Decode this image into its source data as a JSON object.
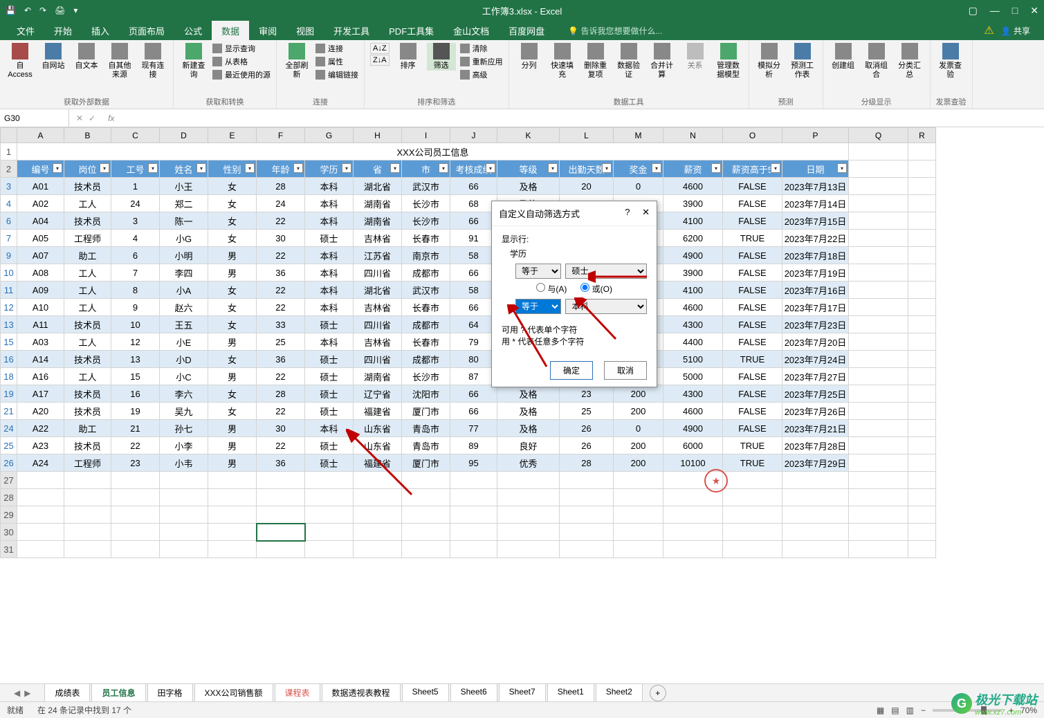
{
  "app": {
    "title": "工作簿3.xlsx - Excel",
    "qat_tooltips": [
      "保存",
      "撤销",
      "重做",
      "打印",
      "新建"
    ],
    "window_controls": [
      "⊞",
      "—",
      "□",
      "✕"
    ]
  },
  "ribbon_tabs": [
    "文件",
    "开始",
    "插入",
    "页面布局",
    "公式",
    "数据",
    "审阅",
    "视图",
    "开发工具",
    "PDF工具集",
    "金山文档",
    "百度网盘"
  ],
  "active_tab": "数据",
  "tellme_placeholder": "告诉我您想要做什么...",
  "share_label": "共享",
  "ribbon": {
    "group1": {
      "btns": [
        "自 Access",
        "自网站",
        "自文本",
        "自其他来源",
        "现有连接"
      ],
      "label": "获取外部数据"
    },
    "group2": {
      "btn": "新建查询",
      "list": [
        "显示查询",
        "从表格",
        "最近使用的源"
      ],
      "label": "获取和转换"
    },
    "group3": {
      "btn": "全部刷新",
      "list": [
        "连接",
        "属性",
        "编辑链接"
      ],
      "label": "连接"
    },
    "group4": {
      "btns": [
        "排序",
        "筛选"
      ],
      "list": [
        "清除",
        "重新应用",
        "高级"
      ],
      "small": [
        "A↓Z",
        "Z↓A"
      ],
      "label": "排序和筛选"
    },
    "group5": {
      "btns": [
        "分列",
        "快速填充",
        "删除重复项",
        "数据验证",
        "合并计算",
        "关系",
        "管理数据模型"
      ],
      "label": "数据工具"
    },
    "group6": {
      "btns": [
        "模拟分析",
        "预测工作表"
      ],
      "label": "预测"
    },
    "group7": {
      "btns": [
        "创建组",
        "取消组合",
        "分类汇总"
      ],
      "label": "分级显示"
    },
    "group8": {
      "btn": "发票查验",
      "label": "发票查验"
    }
  },
  "formula": {
    "cell_ref": "G30",
    "fx": "fx"
  },
  "columns": [
    "A",
    "B",
    "C",
    "D",
    "E",
    "F",
    "G",
    "H",
    "I",
    "J",
    "K",
    "L",
    "M",
    "N",
    "O",
    "P",
    "Q",
    "R"
  ],
  "sheet_title": "XXX公司员工信息",
  "headers": [
    "编号",
    "岗位",
    "工号",
    "姓名",
    "性别",
    "年龄",
    "学历",
    "省",
    "市",
    "考核成绩",
    "等级",
    "出勤天数",
    "奖金",
    "薪资",
    "薪资高于5",
    "日期"
  ],
  "rows": [
    {
      "n": 3,
      "d": [
        "A01",
        "技术员",
        "1",
        "小王",
        "女",
        "28",
        "本科",
        "湖北省",
        "武汉市",
        "66",
        "及格",
        "20",
        "0",
        "4600",
        "FALSE",
        "2023年7月13日"
      ]
    },
    {
      "n": 4,
      "d": [
        "A02",
        "工人",
        "24",
        "郑二",
        "女",
        "24",
        "本科",
        "湖南省",
        "长沙市",
        "68",
        "及格",
        "21",
        "0",
        "3900",
        "FALSE",
        "2023年7月14日"
      ]
    },
    {
      "n": 6,
      "d": [
        "A04",
        "技术员",
        "3",
        "陈一",
        "女",
        "22",
        "本科",
        "湖南省",
        "长沙市",
        "66",
        "",
        "",
        "",
        "4100",
        "FALSE",
        "2023年7月15日"
      ]
    },
    {
      "n": 7,
      "d": [
        "A05",
        "工程师",
        "4",
        "小G",
        "女",
        "30",
        "硕士",
        "吉林省",
        "长春市",
        "91",
        "",
        "",
        "",
        "6200",
        "TRUE",
        "2023年7月22日"
      ]
    },
    {
      "n": 9,
      "d": [
        "A07",
        "助工",
        "6",
        "小明",
        "男",
        "22",
        "本科",
        "江苏省",
        "南京市",
        "58",
        "",
        "",
        "",
        "4900",
        "FALSE",
        "2023年7月18日"
      ]
    },
    {
      "n": 10,
      "d": [
        "A08",
        "工人",
        "7",
        "李四",
        "男",
        "36",
        "本科",
        "四川省",
        "成都市",
        "66",
        "",
        "",
        "",
        "3900",
        "FALSE",
        "2023年7月19日"
      ]
    },
    {
      "n": 11,
      "d": [
        "A09",
        "工人",
        "8",
        "小A",
        "女",
        "22",
        "本科",
        "湖北省",
        "武汉市",
        "58",
        "",
        "",
        "",
        "4100",
        "FALSE",
        "2023年7月16日"
      ]
    },
    {
      "n": 12,
      "d": [
        "A10",
        "工人",
        "9",
        "赵六",
        "女",
        "22",
        "本科",
        "吉林省",
        "长春市",
        "66",
        "",
        "",
        "",
        "4600",
        "FALSE",
        "2023年7月17日"
      ]
    },
    {
      "n": 13,
      "d": [
        "A11",
        "技术员",
        "10",
        "王五",
        "女",
        "33",
        "硕士",
        "四川省",
        "成都市",
        "64",
        "",
        "",
        "",
        "4300",
        "FALSE",
        "2023年7月23日"
      ]
    },
    {
      "n": 15,
      "d": [
        "A03",
        "工人",
        "12",
        "小E",
        "男",
        "25",
        "本科",
        "吉林省",
        "长春市",
        "79",
        "",
        "",
        "",
        "4400",
        "FALSE",
        "2023年7月20日"
      ]
    },
    {
      "n": 16,
      "d": [
        "A14",
        "技术员",
        "13",
        "小D",
        "女",
        "36",
        "硕士",
        "四川省",
        "成都市",
        "80",
        "",
        "",
        "",
        "5100",
        "TRUE",
        "2023年7月24日"
      ]
    },
    {
      "n": 18,
      "d": [
        "A16",
        "工人",
        "15",
        "小C",
        "男",
        "22",
        "硕士",
        "湖南省",
        "长沙市",
        "87",
        "",
        "",
        "",
        "5000",
        "FALSE",
        "2023年7月27日"
      ]
    },
    {
      "n": 19,
      "d": [
        "A17",
        "技术员",
        "16",
        "李六",
        "女",
        "28",
        "硕士",
        "辽宁省",
        "沈阳市",
        "66",
        "及格",
        "23",
        "200",
        "4300",
        "FALSE",
        "2023年7月25日"
      ]
    },
    {
      "n": 21,
      "d": [
        "A20",
        "技术员",
        "19",
        "吴九",
        "女",
        "22",
        "硕士",
        "福建省",
        "厦门市",
        "66",
        "及格",
        "25",
        "200",
        "4600",
        "FALSE",
        "2023年7月26日"
      ]
    },
    {
      "n": 24,
      "d": [
        "A22",
        "助工",
        "21",
        "孙七",
        "男",
        "30",
        "本科",
        "山东省",
        "青岛市",
        "77",
        "及格",
        "26",
        "0",
        "4900",
        "FALSE",
        "2023年7月21日"
      ]
    },
    {
      "n": 25,
      "d": [
        "A23",
        "技术员",
        "22",
        "小李",
        "男",
        "22",
        "硕士",
        "山东省",
        "青岛市",
        "89",
        "良好",
        "26",
        "200",
        "6000",
        "TRUE",
        "2023年7月28日"
      ]
    },
    {
      "n": 26,
      "d": [
        "A24",
        "工程师",
        "23",
        "小韦",
        "男",
        "36",
        "硕士",
        "福建省",
        "厦门市",
        "95",
        "优秀",
        "28",
        "200",
        "10100",
        "TRUE",
        "2023年7月29日"
      ]
    }
  ],
  "empty_rows": [
    27,
    28,
    29,
    30,
    31
  ],
  "dialog": {
    "title": "自定义自动筛选方式",
    "close": "✕",
    "help": "?",
    "show_rows": "显示行:",
    "field": "学历",
    "op1": "等于",
    "val1": "硕士",
    "radio_and": "与(A)",
    "radio_or": "或(O)",
    "op2": "等于",
    "val2": "本科",
    "hint1": "可用 ? 代表单个字符",
    "hint2": "用 * 代表任意多个字符",
    "ok": "确定",
    "cancel": "取消"
  },
  "sheet_tabs": [
    "成绩表",
    "员工信息",
    "田字格",
    "XXX公司销售额",
    "课程表",
    "数据透视表教程",
    "Sheet5",
    "Sheet6",
    "Sheet7",
    "Sheet1",
    "Sheet2"
  ],
  "active_sheet": "员工信息",
  "orange_sheet": "课程表",
  "status": {
    "left": "就绪",
    "records": "在 24 条记录中找到 17 个",
    "zoom": "70%"
  },
  "watermark": {
    "text": "极光下载站",
    "url": "www.xz7.com"
  }
}
